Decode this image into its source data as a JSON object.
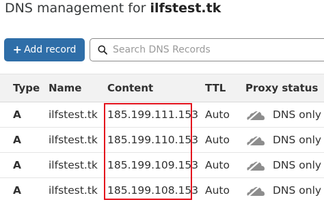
{
  "header": {
    "title_prefix": "DNS management for ",
    "domain": "ilfstest.tk"
  },
  "toolbar": {
    "add_icon": "+",
    "add_label": "Add record",
    "search_placeholder": "Search DNS Records",
    "search_value": ""
  },
  "table": {
    "columns": {
      "type": "Type",
      "name": "Name",
      "content": "Content",
      "ttl": "TTL",
      "proxy": "Proxy status"
    },
    "rows": [
      {
        "type": "A",
        "name": "ilfstest.tk",
        "content": "185.199.111.153",
        "ttl": "Auto",
        "proxy": "DNS only"
      },
      {
        "type": "A",
        "name": "ilfstest.tk",
        "content": "185.199.110.153",
        "ttl": "Auto",
        "proxy": "DNS only"
      },
      {
        "type": "A",
        "name": "ilfstest.tk",
        "content": "185.199.109.153",
        "ttl": "Auto",
        "proxy": "DNS only"
      },
      {
        "type": "A",
        "name": "ilfstest.tk",
        "content": "185.199.108.153",
        "ttl": "Auto",
        "proxy": "DNS only"
      }
    ]
  },
  "icons": {
    "search": "search-icon",
    "proxy_status": "dns-only-cloud-icon"
  },
  "colors": {
    "primary_button": "#2f6ea8",
    "highlight_border": "#e3101b",
    "header_background": "#f2f2f2",
    "cloud_icon": "#8d8d8d"
  }
}
